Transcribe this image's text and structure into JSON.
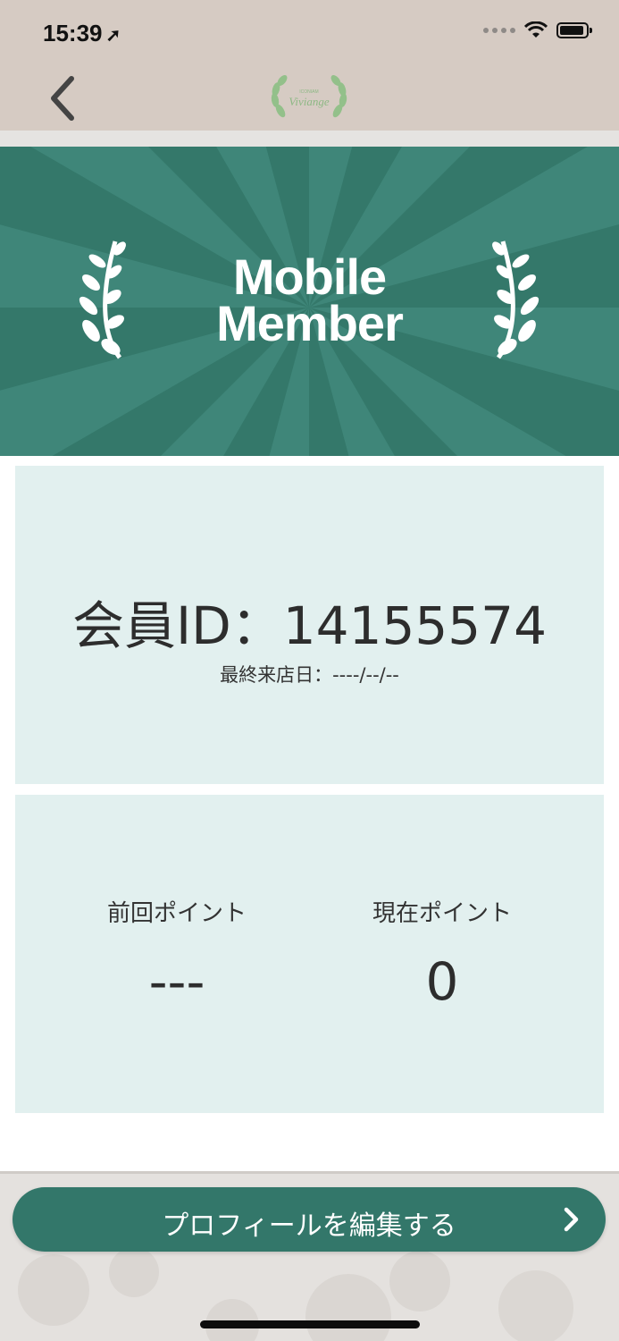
{
  "status_bar": {
    "time": "15:39"
  },
  "logo": {
    "text": "Viviange",
    "subtext": "ICONIAM"
  },
  "banner": {
    "line1": "Mobile",
    "line2": "Member"
  },
  "member": {
    "id_text": "会員ID：14155574",
    "last_visit": "最終来店日：----/--/--"
  },
  "points": {
    "previous_label": "前回ポイント",
    "previous_value": "---",
    "current_label": "現在ポイント",
    "current_value": "0"
  },
  "footer": {
    "edit_profile_label": "プロフィールを編集する"
  },
  "colors": {
    "brand_green": "#34786a",
    "card_bg": "#e2f0ef",
    "nav_bg": "#d6cbc3"
  }
}
